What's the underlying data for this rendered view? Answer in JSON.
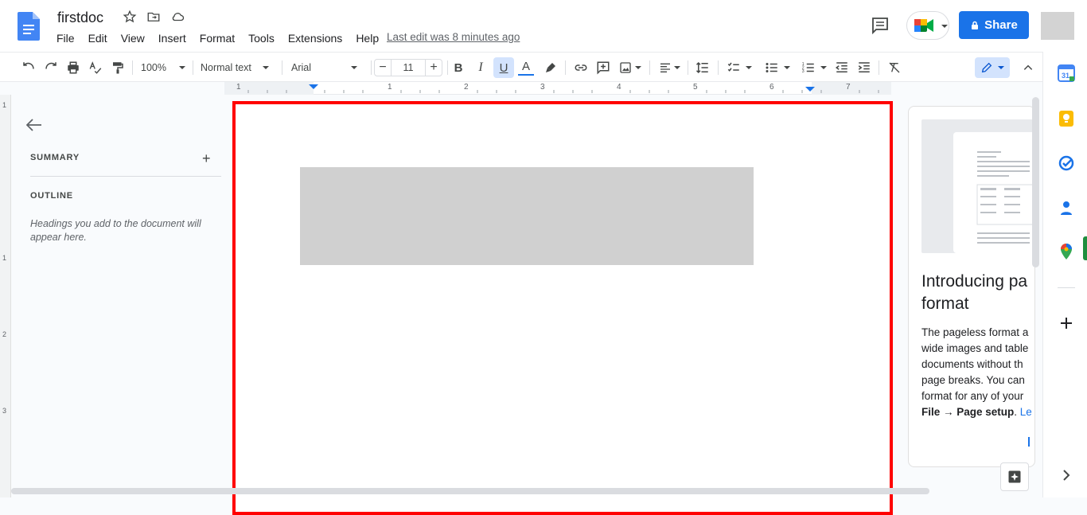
{
  "app": {
    "doc_title": "firstdoc",
    "last_edit": "Last edit was 8 minutes ago",
    "share_label": "Share"
  },
  "menu": [
    "File",
    "Edit",
    "View",
    "Insert",
    "Format",
    "Tools",
    "Extensions",
    "Help"
  ],
  "toolbar": {
    "zoom": "100%",
    "style": "Normal text",
    "font": "Arial",
    "font_size": "11",
    "text_color": "#1a73e8"
  },
  "ruler": {
    "marks": [
      "1",
      "1",
      "2",
      "3",
      "4",
      "5",
      "6",
      "7"
    ],
    "vmarks": [
      "1",
      "1",
      "2",
      "3"
    ]
  },
  "outline_panel": {
    "summary_label": "SUMMARY",
    "outline_label": "OUTLINE",
    "hint": "Headings you add to the document will appear here."
  },
  "side_card": {
    "title_line1": "Introducing pa",
    "title_line2": "format",
    "body_lines": [
      "The pageless format a",
      "wide images and table",
      "documents without th",
      "page breaks. You can",
      "format for any of your"
    ],
    "body_bold": "File → Page setup",
    "body_tail": ". ",
    "link_text": "Le"
  },
  "colors": {
    "share_blue": "#1a73e8",
    "highlight_border": "#ff0000",
    "image_placeholder": "#d0d0d0"
  }
}
